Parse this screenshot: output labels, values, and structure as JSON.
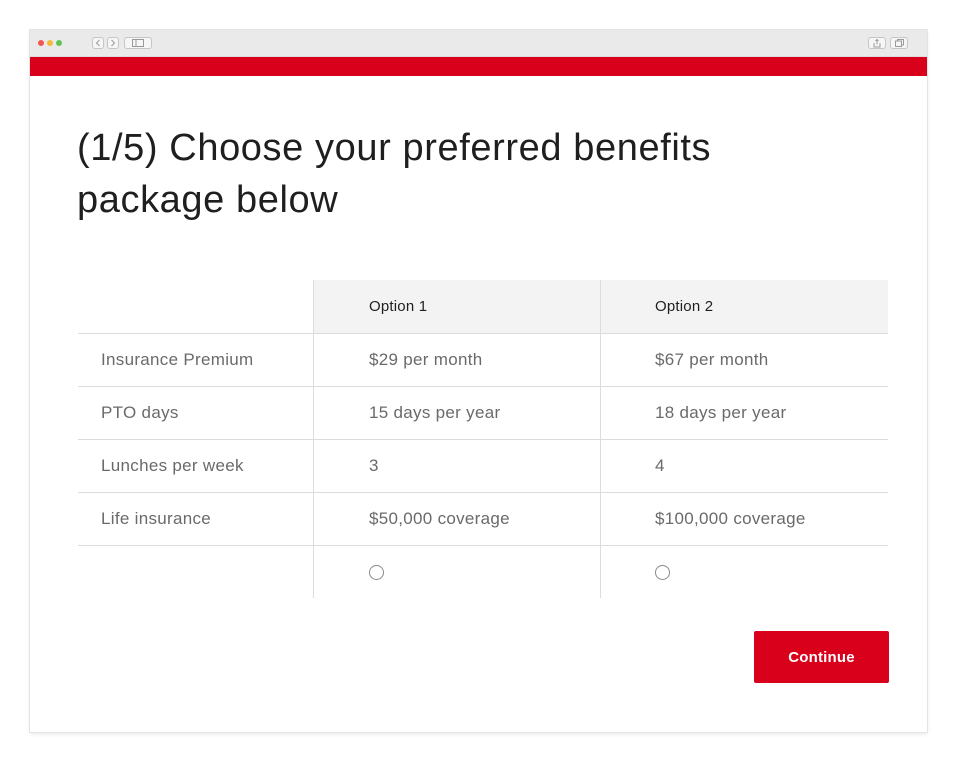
{
  "colors": {
    "brand_red": "#d8001a",
    "header_bg": "#f3f3f3"
  },
  "window_chrome": {
    "icons": [
      "back-icon",
      "forward-icon",
      "sidebar-icon",
      "share-icon",
      "tabs-icon"
    ]
  },
  "page": {
    "title": "(1/5) Choose your preferred benefits package below"
  },
  "table": {
    "columns": [
      "",
      "Option 1",
      "Option 2"
    ],
    "rows": [
      {
        "label": "Insurance Premium",
        "option1": "$29 per month",
        "option2": "$67 per month"
      },
      {
        "label": "PTO days",
        "option1": "15 days per year",
        "option2": "18 days per year"
      },
      {
        "label": "Lunches per week",
        "option1": "3",
        "option2": "4"
      },
      {
        "label": "Life insurance",
        "option1": "$50,000 coverage",
        "option2": "$100,000 coverage"
      }
    ],
    "selection": {
      "option1_selected": false,
      "option2_selected": false
    }
  },
  "continue_button": {
    "label": "Continue"
  }
}
